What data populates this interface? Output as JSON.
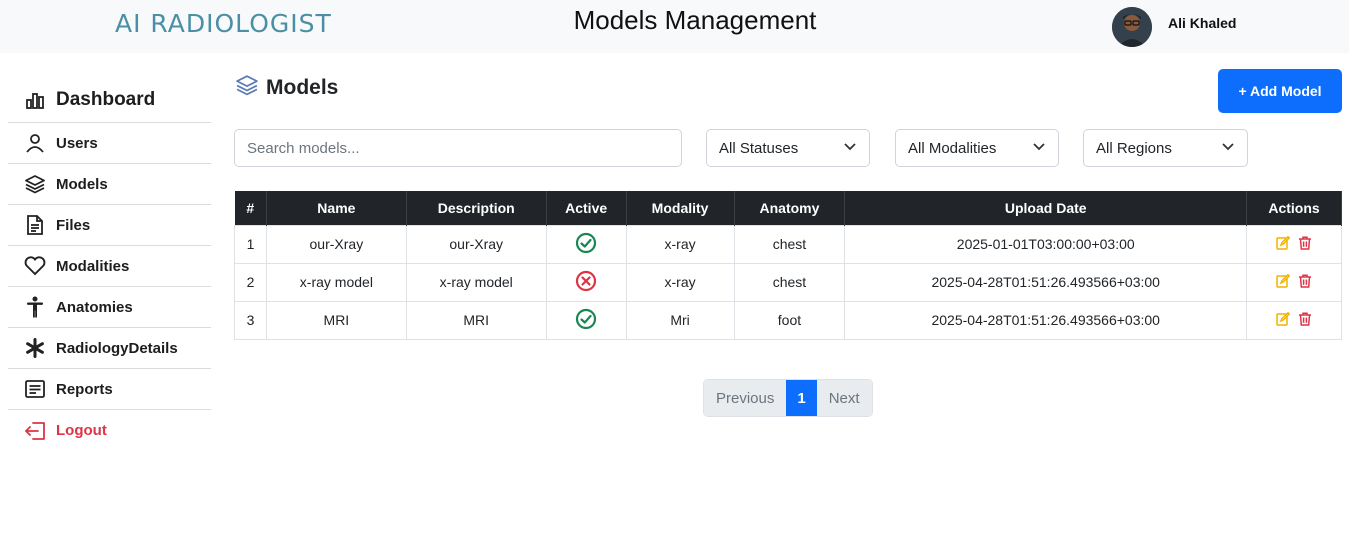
{
  "header": {
    "logo_text": "AI RADIOLOGIST",
    "title": "Models Management",
    "user_name": "Ali Khaled"
  },
  "sidebar": {
    "items": [
      {
        "label": "Dashboard",
        "icon": "chart-bar-icon"
      },
      {
        "label": "Users",
        "icon": "user-icon"
      },
      {
        "label": "Models",
        "icon": "layers-icon"
      },
      {
        "label": "Files",
        "icon": "file-text-icon"
      },
      {
        "label": "Modalities",
        "icon": "heart-icon"
      },
      {
        "label": "Anatomies",
        "icon": "person-icon"
      },
      {
        "label": "RadiologyDetails",
        "icon": "asterisk-icon"
      },
      {
        "label": "Reports",
        "icon": "report-icon"
      },
      {
        "label": "Logout",
        "icon": "logout-icon"
      }
    ]
  },
  "main": {
    "title": "Models",
    "add_button": "+ Add Model",
    "search_placeholder": "Search models...",
    "filters": {
      "status": "All Statuses",
      "modality": "All Modalities",
      "region": "All Regions"
    }
  },
  "table": {
    "headers": [
      "#",
      "Name",
      "Description",
      "Active",
      "Modality",
      "Anatomy",
      "Upload Date",
      "Actions"
    ],
    "rows": [
      {
        "index": "1",
        "name": "our-Xray",
        "description": "our-Xray",
        "active": true,
        "modality": "x-ray",
        "anatomy": "chest",
        "upload_date": "2025-01-01T03:00:00+03:00"
      },
      {
        "index": "2",
        "name": "x-ray model",
        "description": "x-ray model",
        "active": false,
        "modality": "x-ray",
        "anatomy": "chest",
        "upload_date": "2025-04-28T01:51:26.493566+03:00"
      },
      {
        "index": "3",
        "name": "MRI",
        "description": "MRI",
        "active": true,
        "modality": "Mri",
        "anatomy": "foot",
        "upload_date": "2025-04-28T01:51:26.493566+03:00"
      }
    ]
  },
  "pagination": {
    "previous": "Previous",
    "current": "1",
    "next": "Next"
  },
  "colors": {
    "primary": "#0d6efd",
    "success": "#198754",
    "danger": "#dc3545",
    "warning": "#ffc107",
    "table_header": "#212529"
  }
}
